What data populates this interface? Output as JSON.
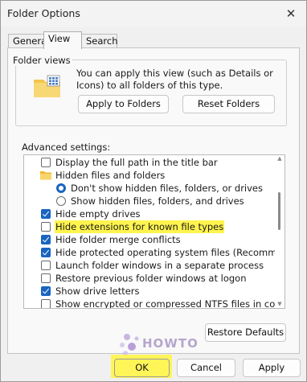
{
  "window": {
    "title": "Folder Options",
    "close_icon": "close-icon"
  },
  "tabs": [
    {
      "label": "General",
      "active": false
    },
    {
      "label": "View",
      "active": true
    },
    {
      "label": "Search",
      "active": false
    }
  ],
  "folder_views": {
    "label": "Folder views",
    "icon": "folder-icon",
    "description": "You can apply this view (such as Details or Icons) to all folders of this type.",
    "apply_button": "Apply to Folders",
    "reset_button": "Reset Folders"
  },
  "advanced": {
    "label": "Advanced settings:",
    "items": [
      {
        "type": "checkbox",
        "label": "Display the full path in the title bar",
        "checked": false,
        "indent": 0,
        "highlighted": false
      },
      {
        "type": "folder",
        "label": "Hidden files and folders",
        "indent": 0,
        "highlighted": false
      },
      {
        "type": "radio",
        "label": "Don't show hidden files, folders, or drives",
        "checked": true,
        "indent": 1,
        "highlighted": false
      },
      {
        "type": "radio",
        "label": "Show hidden files, folders, and drives",
        "checked": false,
        "indent": 1,
        "highlighted": false
      },
      {
        "type": "checkbox",
        "label": "Hide empty drives",
        "checked": true,
        "indent": 0,
        "highlighted": false
      },
      {
        "type": "checkbox",
        "label": "Hide extensions for known file types",
        "checked": false,
        "indent": 0,
        "highlighted": true
      },
      {
        "type": "checkbox",
        "label": "Hide folder merge conflicts",
        "checked": true,
        "indent": 0,
        "highlighted": false
      },
      {
        "type": "checkbox",
        "label": "Hide protected operating system files (Recommended)",
        "checked": true,
        "indent": 0,
        "highlighted": false
      },
      {
        "type": "checkbox",
        "label": "Launch folder windows in a separate process",
        "checked": false,
        "indent": 0,
        "highlighted": false
      },
      {
        "type": "checkbox",
        "label": "Restore previous folder windows at logon",
        "checked": false,
        "indent": 0,
        "highlighted": false
      },
      {
        "type": "checkbox",
        "label": "Show drive letters",
        "checked": true,
        "indent": 0,
        "highlighted": false
      },
      {
        "type": "checkbox",
        "label": "Show encrypted or compressed NTFS files in color",
        "checked": false,
        "indent": 0,
        "highlighted": false
      }
    ],
    "restore_button": "Restore Defaults"
  },
  "footer": {
    "ok_button": "OK",
    "cancel_button": "Cancel",
    "apply_button": "Apply"
  },
  "watermark": {
    "text": "HOWTO"
  },
  "colors": {
    "accent": "#1964c0",
    "highlight": "#fff44f"
  }
}
